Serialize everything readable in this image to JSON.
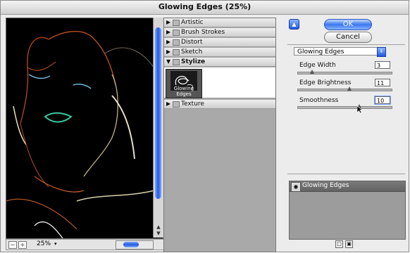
{
  "window": {
    "title": "Glowing Edges (25%)"
  },
  "preview": {
    "zoom": "25%"
  },
  "categories": [
    {
      "label": "Artistic",
      "expanded": false
    },
    {
      "label": "Brush Strokes",
      "expanded": false
    },
    {
      "label": "Distort",
      "expanded": false
    },
    {
      "label": "Sketch",
      "expanded": false
    },
    {
      "label": "Stylize",
      "expanded": true
    },
    {
      "label": "Texture",
      "expanded": false
    }
  ],
  "selected_filter_thumb": "Glowing Edges",
  "buttons": {
    "ok": "OK",
    "cancel": "Cancel"
  },
  "filter_dropdown": {
    "selected": "Glowing Edges"
  },
  "settings": [
    {
      "label": "Edge Width",
      "value": "3"
    },
    {
      "label": "Edge Brightness",
      "value": "11"
    },
    {
      "label": "Smoothness",
      "value": "10"
    }
  ],
  "layers": [
    {
      "label": "Glowing Edges"
    }
  ],
  "colors": {
    "accent_blue": "#1f5ae0",
    "preview_bg": "#000000"
  },
  "icons": {
    "up": "triangle-up-icon",
    "dropdown": "dropdown-arrows-icon",
    "eye": "visibility-icon",
    "new_layer": "new-layer-icon",
    "delete_layer": "trash-icon",
    "zoom_out": "minus-icon",
    "zoom_in": "plus-icon",
    "collapse": "triangle-right-icon",
    "expanded": "triangle-down-icon",
    "folder": "folder-icon"
  }
}
